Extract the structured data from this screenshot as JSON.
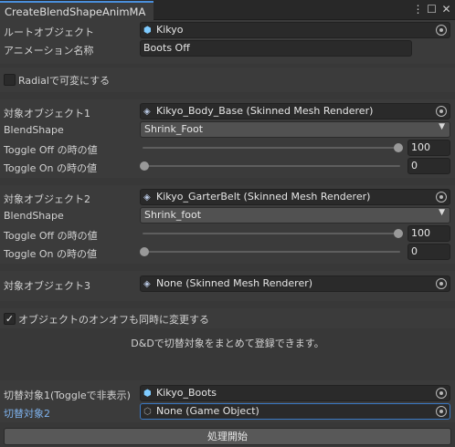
{
  "window": {
    "tab_title": "CreateBlendShapeAnimMA",
    "icons": [
      "more-icon",
      "maximize-icon",
      "close-icon"
    ]
  },
  "root": {
    "label": "ルートオブジェクト",
    "value": "Kikyo",
    "icon": "game-object-icon"
  },
  "animation": {
    "label": "アニメーション名称",
    "value": "Boots Off"
  },
  "radial": {
    "label": "Radialで可変にする",
    "checked": false
  },
  "targets": [
    {
      "object_label": "対象オブジェクト1",
      "object_value": "Kikyo_Body_Base (Skinned Mesh Renderer)",
      "blendshape_label": "BlendShape",
      "blendshape_value": "Shrink_Foot",
      "off_label": "Toggle Off の時の値",
      "off_value": "100",
      "off_level": 1,
      "on_label": "Toggle On の時の値",
      "on_value": "0",
      "on_level": 0
    },
    {
      "object_label": "対象オブジェクト2",
      "object_value": "Kikyo_GarterBelt (Skinned Mesh Renderer)",
      "blendshape_label": "BlendShape",
      "blendshape_value": "Shrink_foot",
      "off_label": "Toggle Off の時の値",
      "off_value": "100",
      "off_level": 1,
      "on_label": "Toggle On の時の値",
      "on_value": "0",
      "on_level": 0
    },
    {
      "object_label": "対象オブジェクト3",
      "object_value": "None (Skinned Mesh Renderer)"
    }
  ],
  "sync": {
    "label": "オブジェクトのオンオフも同時に変更する",
    "checked": true
  },
  "help_text": "D&Dで切替対象をまとめて登録できます。",
  "switch_targets": [
    {
      "label": "切替対象1(Toggleで非表示)",
      "value": "Kikyo_Boots"
    },
    {
      "label": "切替対象2",
      "value": "None (Game Object)"
    }
  ],
  "run_button": "処理開始",
  "colors": {
    "accent": "#4a8fdc",
    "link_label": "#7fb3ee",
    "background": "#383838",
    "field": "#2a2a2a"
  }
}
